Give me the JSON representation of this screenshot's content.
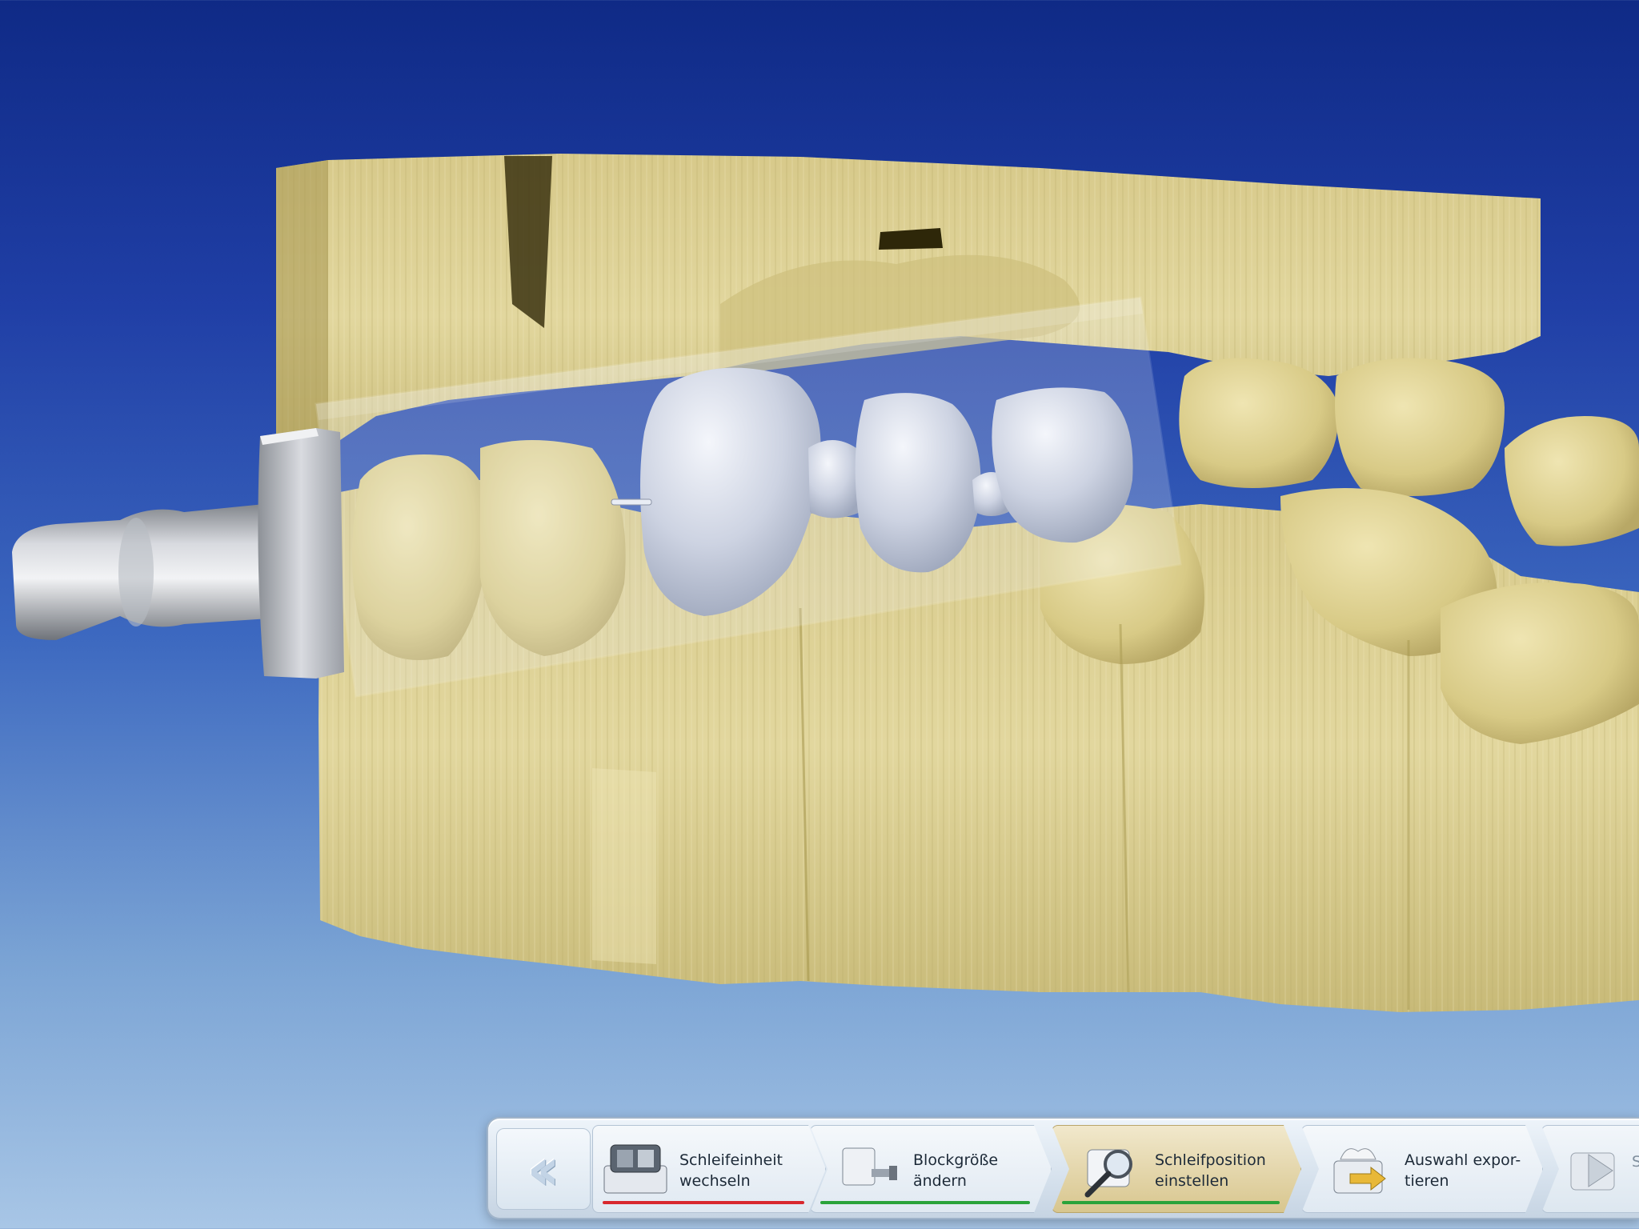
{
  "toolbar": {
    "back_icon": "double-chevron-left-icon",
    "steps": [
      {
        "label": "Schleifeinheit\nwechseln",
        "icon": "milling-unit-icon",
        "status_color": "#d8282e",
        "active": false
      },
      {
        "label": "Blockgröße\nändern",
        "icon": "block-size-icon",
        "status_color": "#2aa33a",
        "active": false
      },
      {
        "label": "Schleifposition\neinstellen",
        "icon": "magnifier-icon",
        "status_color": "#2aa33a",
        "active": true
      },
      {
        "label": "Auswahl expor-\ntieren",
        "icon": "export-selection-icon",
        "status_color": null,
        "active": false
      },
      {
        "label": "Sc",
        "icon": "next-step-icon",
        "status_color": null,
        "active": false
      }
    ]
  },
  "colors": {
    "background_top": "#0f2a86",
    "background_bottom": "#a8c6e6",
    "dental_model": "#d9cc8a",
    "restoration": "#c8cfdf",
    "block_holder": "#b9bcc2",
    "active_step": "#d8c68e"
  }
}
